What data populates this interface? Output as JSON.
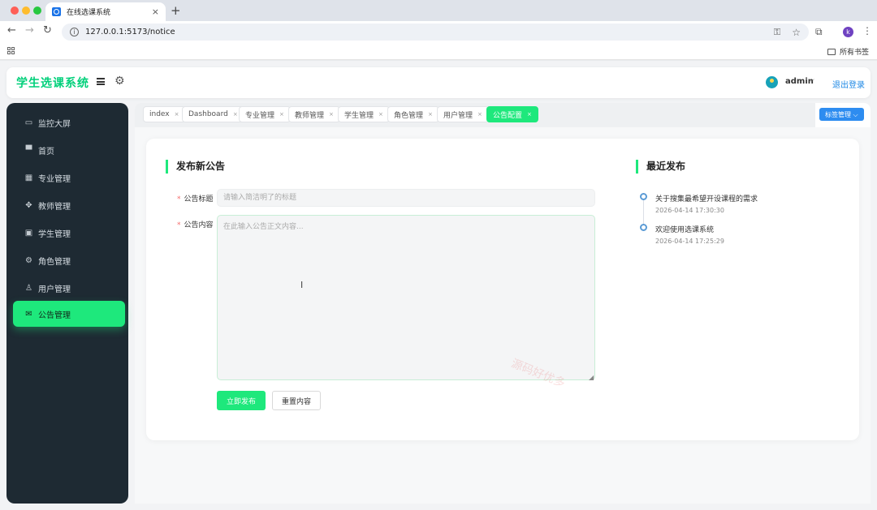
{
  "browser": {
    "tab_title": "在线选课系统",
    "tab_close": "×",
    "new_tab": "+",
    "url": "127.0.0.1:5173/notice",
    "bookmarks_all": "所有书签",
    "profile_initial": "k"
  },
  "header": {
    "brand": "学生选课系统",
    "user": "admin",
    "user_caret": "⌵",
    "logout": "退出登录"
  },
  "sidebar": {
    "items": [
      {
        "label": "监控大屏",
        "icon": "monitor-icon"
      },
      {
        "label": "首页",
        "icon": "desktop-icon"
      },
      {
        "label": "专业管理",
        "icon": "building-icon"
      },
      {
        "label": "教师管理",
        "icon": "move-icon"
      },
      {
        "label": "学生管理",
        "icon": "briefcase-icon"
      },
      {
        "label": "角色管理",
        "icon": "gear-icon"
      },
      {
        "label": "用户管理",
        "icon": "user-icon"
      },
      {
        "label": "公告管理",
        "icon": "mail-icon",
        "active": true
      }
    ]
  },
  "tags": {
    "items": [
      {
        "label": "index"
      },
      {
        "label": "Dashboard"
      },
      {
        "label": "专业管理"
      },
      {
        "label": "教师管理"
      },
      {
        "label": "学生管理"
      },
      {
        "label": "角色管理"
      },
      {
        "label": "用户管理"
      },
      {
        "label": "公告配置",
        "active": true
      }
    ],
    "close_glyph": "×",
    "manage_label": "标签管理 ⌵"
  },
  "publish": {
    "title": "发布新公告",
    "title_label": "公告标题",
    "title_placeholder": "请输入简洁明了的标题",
    "content_label": "公告内容",
    "content_placeholder": "在此输入公告正文内容...",
    "required_mark": "*",
    "publish_button": "立即发布",
    "reset_button": "重置内容"
  },
  "recent": {
    "title": "最近发布",
    "items": [
      {
        "title": "关于搜集最希望开设课程的需求",
        "time": "2026-04-14 17:30:30"
      },
      {
        "title": "欢迎使用选课系统",
        "time": "2026-04-14 17:25:29"
      }
    ]
  },
  "watermark": "源码好优多",
  "colors": {
    "accent": "#1ee87c",
    "brand": "#00d07a",
    "sidebar_bg": "#1e2a33",
    "link": "#1e88e5",
    "tag_manage": "#2d8cf0"
  }
}
